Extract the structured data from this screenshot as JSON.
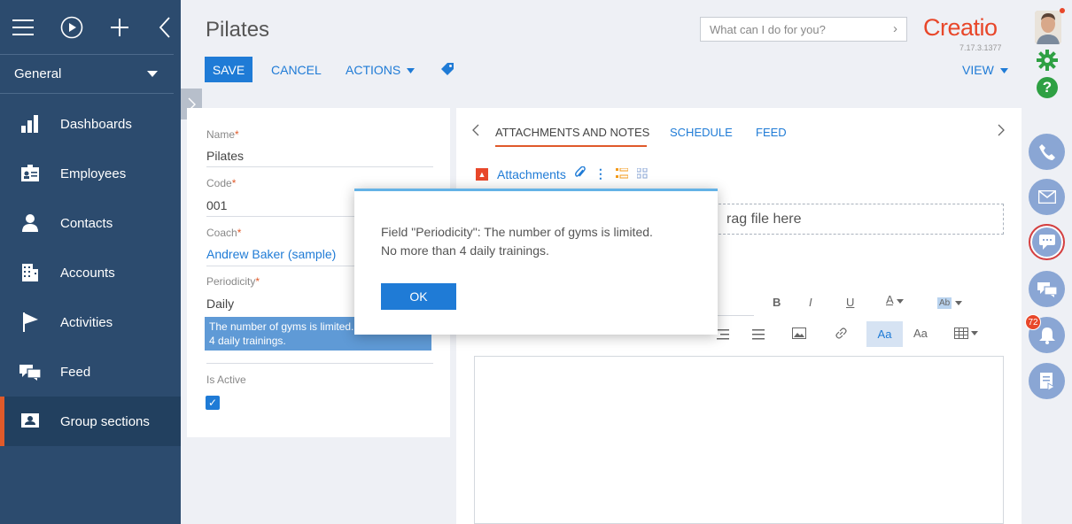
{
  "sidebar": {
    "section": "General",
    "items": [
      {
        "label": "Dashboards"
      },
      {
        "label": "Employees"
      },
      {
        "label": "Contacts"
      },
      {
        "label": "Accounts"
      },
      {
        "label": "Activities"
      },
      {
        "label": "Feed"
      },
      {
        "label": "Group sections"
      }
    ]
  },
  "header": {
    "title": "Pilates",
    "save_label": "SAVE",
    "cancel_label": "CANCEL",
    "actions_label": "ACTIONS",
    "view_label": "VIEW",
    "search_placeholder": "What can I do for you?",
    "logo": "Creatio",
    "version": "7.17.3.1377"
  },
  "form": {
    "name_label": "Name",
    "name_value": "Pilates",
    "code_label": "Code",
    "code_value": "001",
    "coach_label": "Coach",
    "coach_value": "Andrew Baker (sample)",
    "periodicity_label": "Periodicity",
    "periodicity_value": "Daily",
    "tooltip": "The number of gyms is limited. No more than 4 daily trainings.",
    "active_label": "Is Active",
    "required_mark": "*"
  },
  "tabs": {
    "items": [
      "ATTACHMENTS AND NOTES",
      "SCHEDULE",
      "FEED"
    ],
    "attachments_label": "Attachments",
    "dropzone_text": "rag file here"
  },
  "editor_toolbar": {
    "bold": "B",
    "italic": "I",
    "underline": "U",
    "font_color": "A",
    "highlight": "Ab",
    "case1": "Aa",
    "case2": "Aa"
  },
  "rail": {
    "notification_count": "72"
  },
  "modal": {
    "line1": "Field \"Periodicity\": The number of gyms is limited.",
    "line2": "No more than 4 daily trainings.",
    "ok_label": "OK"
  },
  "colors": {
    "sidebar": "#2c4b6e",
    "accent": "#1f7bd6",
    "brand": "#e8472a"
  }
}
